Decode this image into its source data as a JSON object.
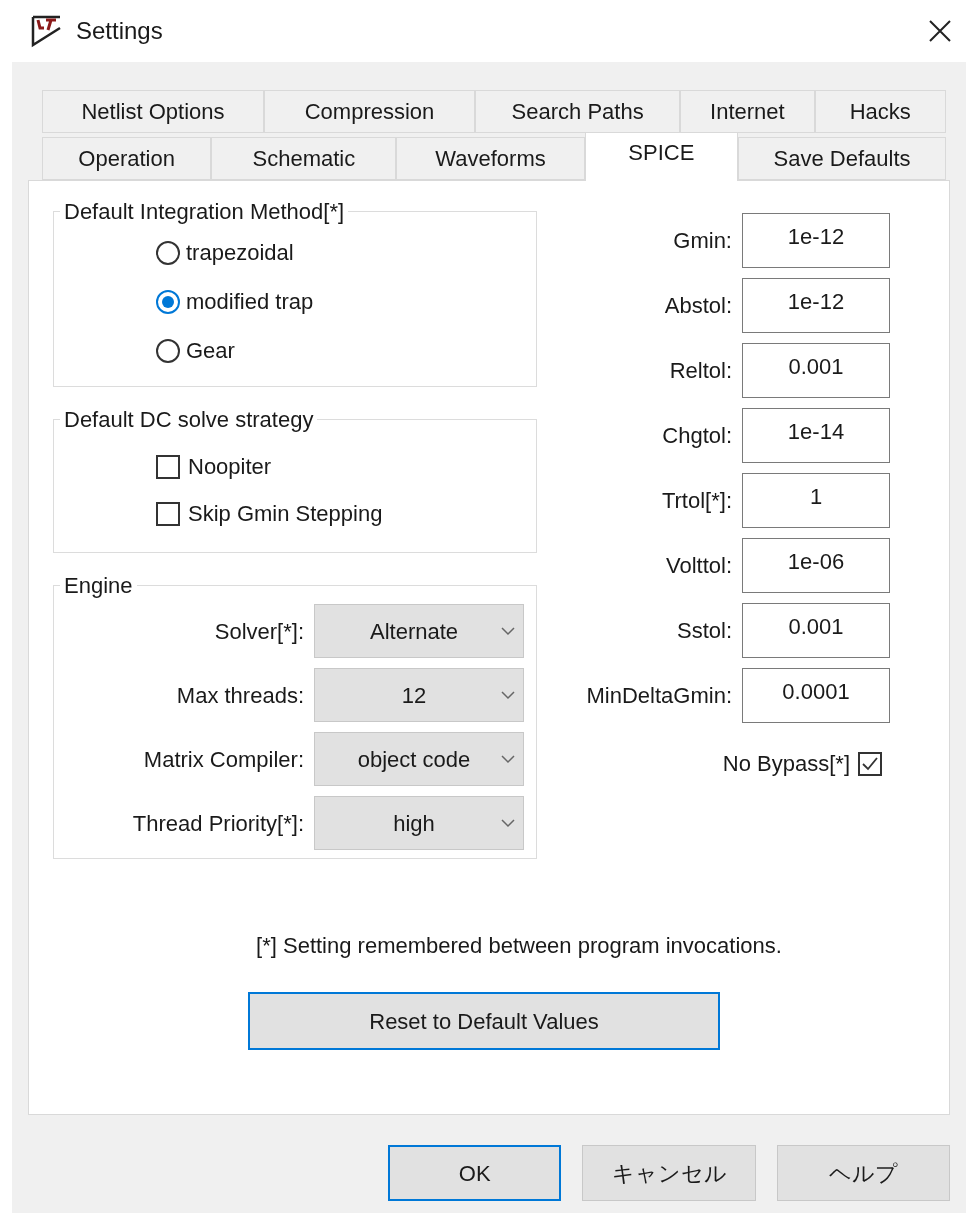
{
  "window": {
    "title": "Settings"
  },
  "tab_rows": [
    {
      "tabs": [
        {
          "label": "Netlist Options",
          "selected": false
        },
        {
          "label": "Compression",
          "selected": false
        },
        {
          "label": "Search Paths",
          "selected": false
        },
        {
          "label": "Internet",
          "selected": false
        },
        {
          "label": "Hacks",
          "selected": false
        }
      ]
    },
    {
      "tabs": [
        {
          "label": "Operation",
          "selected": false
        },
        {
          "label": "Schematic",
          "selected": false
        },
        {
          "label": "Waveforms",
          "selected": false
        },
        {
          "label": "SPICE",
          "selected": true
        },
        {
          "label": "Save Defaults",
          "selected": false
        }
      ]
    }
  ],
  "integration_method": {
    "title": "Default Integration Method[*]",
    "options": [
      {
        "label": "trapezoidal",
        "selected": false
      },
      {
        "label": "modified trap",
        "selected": true
      },
      {
        "label": "Gear",
        "selected": false
      }
    ]
  },
  "dc_strategy": {
    "title": "Default DC solve strategy",
    "options": [
      {
        "label": "Noopiter",
        "checked": false
      },
      {
        "label": "Skip Gmin Stepping",
        "checked": false
      }
    ]
  },
  "engine": {
    "title": "Engine",
    "settings": [
      {
        "label": "Solver[*]:",
        "value": "Alternate"
      },
      {
        "label": "Max threads:",
        "value": "12"
      },
      {
        "label": "Matrix Compiler:",
        "value": "object code"
      },
      {
        "label": "Thread Priority[*]:",
        "value": "high"
      }
    ]
  },
  "tolerances": [
    {
      "label": "Gmin:",
      "value": "1e-12"
    },
    {
      "label": "Abstol:",
      "value": "1e-12"
    },
    {
      "label": "Reltol:",
      "value": "0.001"
    },
    {
      "label": "Chgtol:",
      "value": "1e-14"
    },
    {
      "label": "Trtol[*]:",
      "value": "1"
    },
    {
      "label": "Volttol:",
      "value": "1e-06"
    },
    {
      "label": "Sstol:",
      "value": "0.001"
    },
    {
      "label": "MinDeltaGmin:",
      "value": "0.0001"
    }
  ],
  "no_bypass": {
    "label": "No Bypass[*]",
    "checked": true
  },
  "note": "[*] Setting remembered between program invocations.",
  "reset_button": "Reset to Default Values",
  "buttons": [
    {
      "label": "OK",
      "default": true
    },
    {
      "label": "キャンセル",
      "default": false
    },
    {
      "label": "ヘルプ",
      "default": false
    }
  ]
}
